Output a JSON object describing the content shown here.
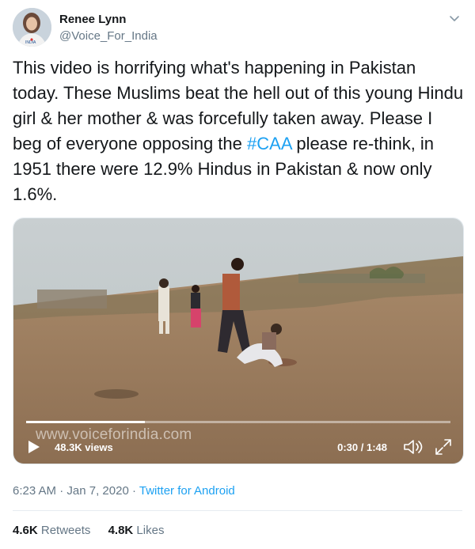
{
  "user": {
    "name": "Renee Lynn",
    "handle": "@Voice_For_India",
    "avatar_badge": "INDIA"
  },
  "tweet": {
    "text_before": "This video is horrifying what's happening in Pakistan today. These Muslims beat the hell out of this young Hindu girl & her mother & was forcefully taken away. Please I beg of everyone opposing the ",
    "hashtag": "#CAA",
    "text_after": " please re-think, in 1951 there were 12.9% Hindus in Pakistan & now only 1.6%."
  },
  "video": {
    "watermark": "www.voiceforindia.com",
    "views": "48.3K views",
    "time": "0:30 / 1:48",
    "progress": 0.28
  },
  "meta": {
    "time": "6:23 AM",
    "sep1": " · ",
    "date": "Jan 7, 2020",
    "sep2": " · ",
    "source": "Twitter for Android"
  },
  "stats": {
    "retweets_count": "4.6K",
    "retweets_label": "Retweets",
    "likes_count": "4.8K",
    "likes_label": "Likes"
  },
  "colors": {
    "accent": "#1da1f2",
    "secondary_text": "#657786"
  }
}
